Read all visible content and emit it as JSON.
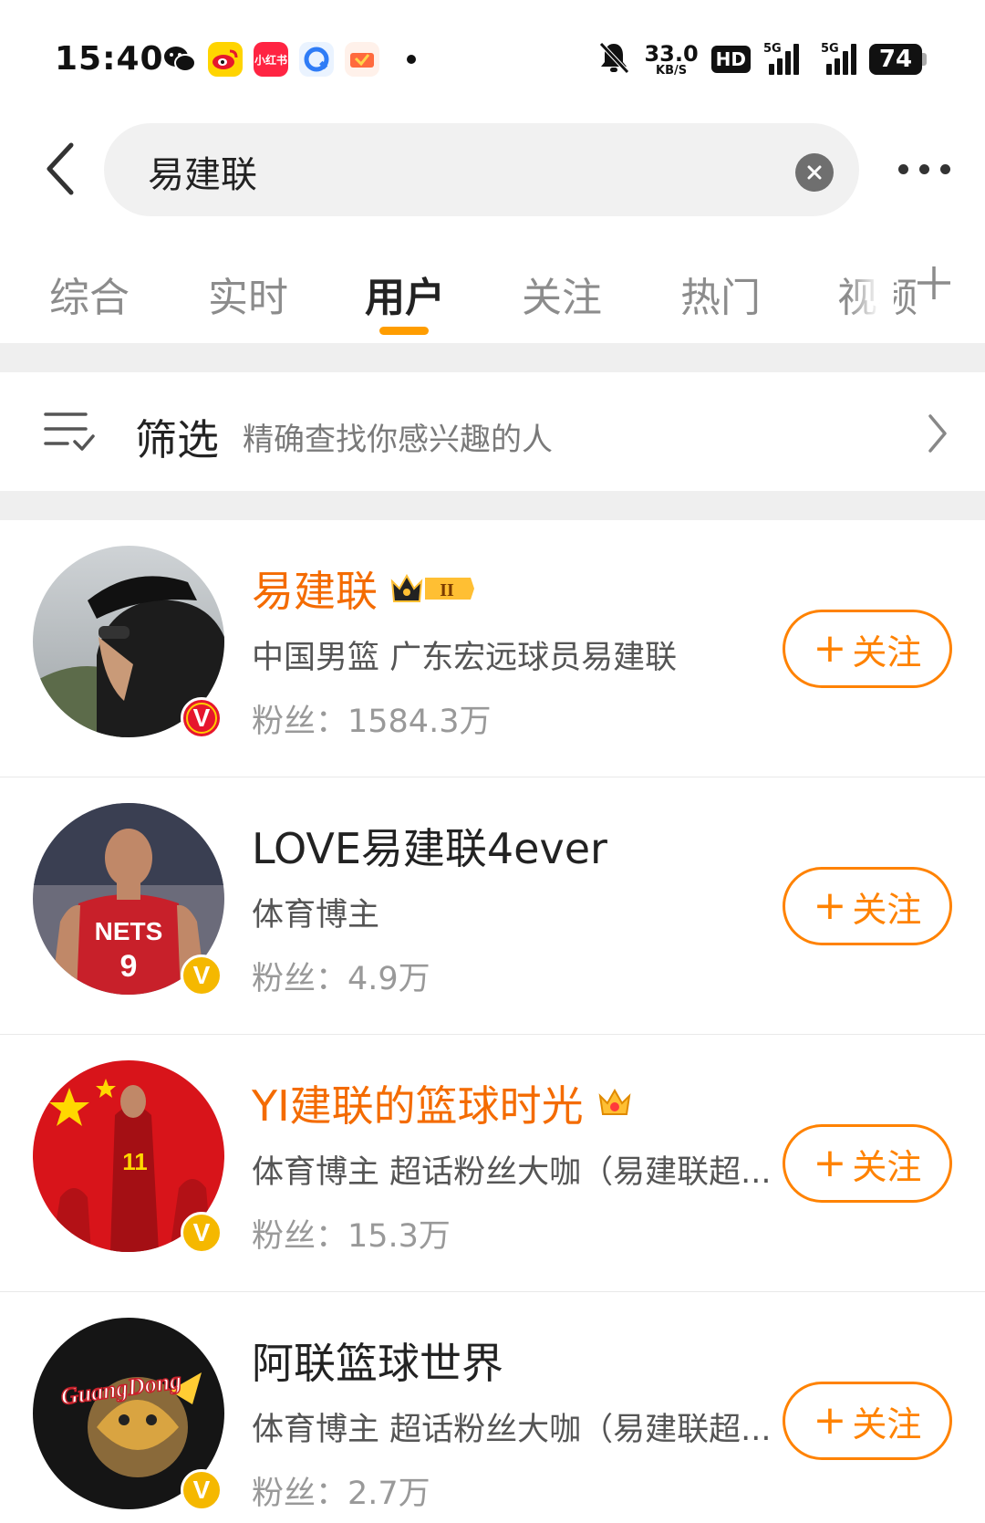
{
  "status_bar": {
    "time": "15:40",
    "net_speed_value": "33.0",
    "net_speed_unit": "KB/S",
    "hd_label": "HD",
    "signal_label_1": "5G",
    "signal_label_2": "5G",
    "battery": "74",
    "app_icons": [
      "wechat-icon",
      "weibo-icon",
      "xiaohongshu-icon",
      "browser-icon",
      "game-icon"
    ],
    "app_icon_text_xhs": "小红书"
  },
  "search": {
    "query": "易建联"
  },
  "tabs": [
    {
      "label": "综合",
      "active": false
    },
    {
      "label": "实时",
      "active": false
    },
    {
      "label": "用户",
      "active": true
    },
    {
      "label": "关注",
      "active": false
    },
    {
      "label": "热门",
      "active": false
    },
    {
      "label": "视频",
      "active": false
    }
  ],
  "filter": {
    "title": "筛选",
    "subtitle": "精确查找你感兴趣的人"
  },
  "follow_label": "关注",
  "follow_plus": "+",
  "users": [
    {
      "name": "易建联",
      "name_color": "#f46b00",
      "badge": "crown-level-icon",
      "badge_text": "II",
      "description": "中国男篮 广东宏远球员易建联",
      "fans": "粉丝：1584.3万",
      "verified": "red",
      "verified_letter": "V"
    },
    {
      "name": "LOVE易建联4ever",
      "name_color": "#222222",
      "description": "体育博主",
      "fans": "粉丝：4.9万",
      "verified": "gold",
      "verified_letter": "V"
    },
    {
      "name": "YI建联的篮球时光",
      "name_color": "#f46b00",
      "badge": "crown-icon",
      "description": "体育博主 超话粉丝大咖（易建联超...",
      "fans": "粉丝：15.3万",
      "verified": "gold",
      "verified_letter": "V"
    },
    {
      "name": "阿联篮球世界",
      "name_color": "#222222",
      "description": "体育博主 超话粉丝大咖（易建联超...",
      "fans": "粉丝：2.7万",
      "verified": "gold",
      "verified_letter": "V",
      "avatar_text": "GuangDong"
    }
  ],
  "colors": {
    "accent": "#ff8200",
    "tab_indicator": "#ff9d00",
    "highlight_name": "#f46b00"
  }
}
